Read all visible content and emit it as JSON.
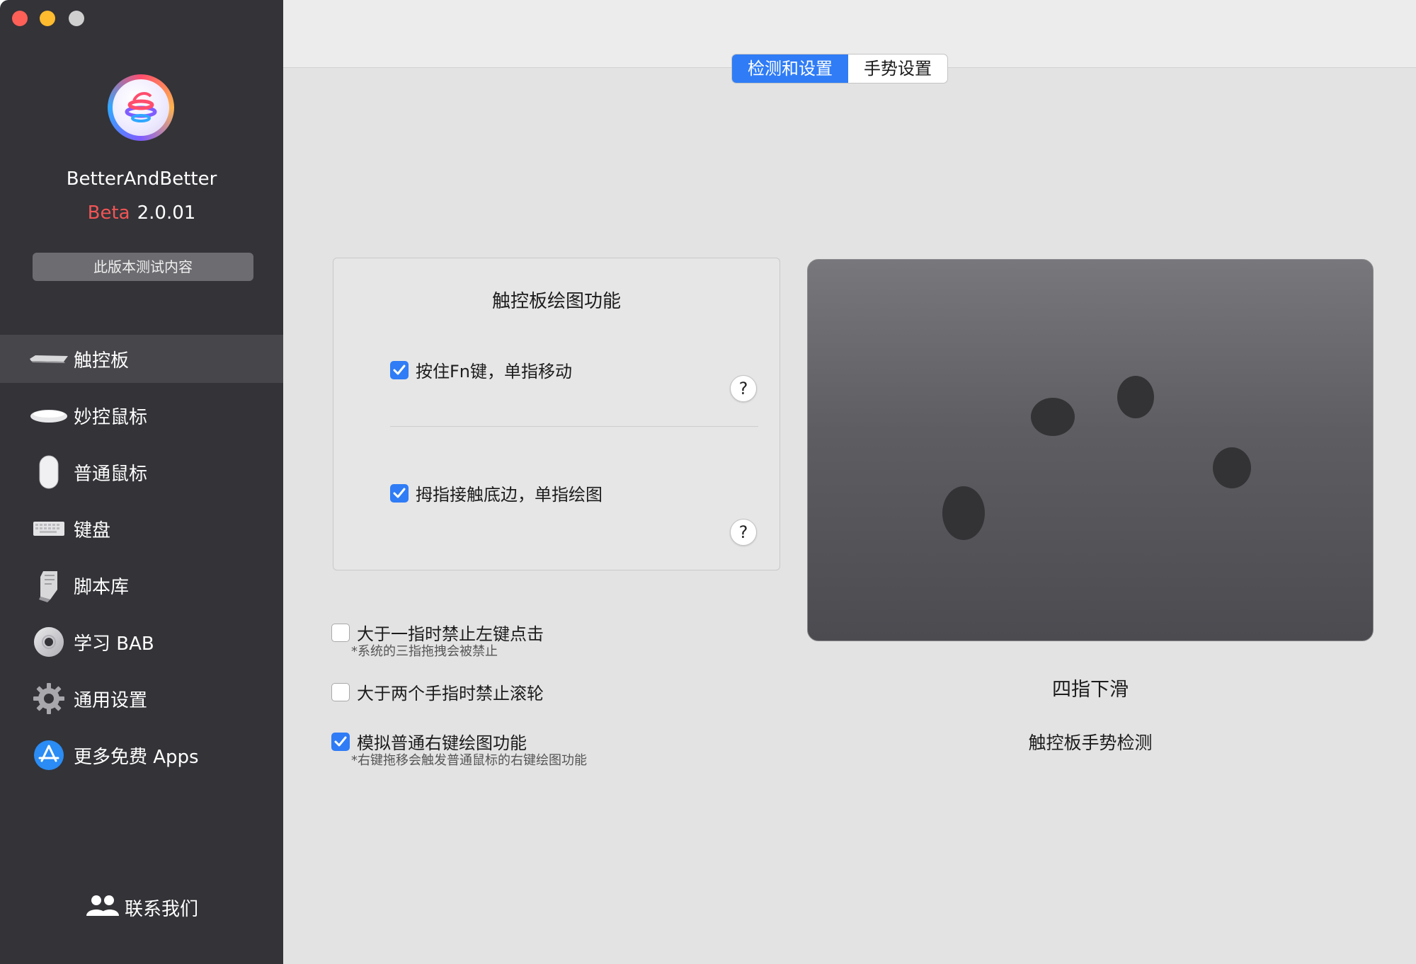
{
  "sidebar": {
    "app_name": "BetterAndBetter",
    "beta_label": "Beta",
    "version": "2.0.01",
    "test_content_button": "此版本测试内容",
    "items": [
      {
        "label": "触控板",
        "icon": "trackpad-icon",
        "active": true
      },
      {
        "label": "妙控鼠标",
        "icon": "magic-mouse-icon",
        "active": false
      },
      {
        "label": "普通鼠标",
        "icon": "mouse-icon",
        "active": false
      },
      {
        "label": "键盘",
        "icon": "keyboard-icon",
        "active": false
      },
      {
        "label": "脚本库",
        "icon": "script-library-icon",
        "active": false
      },
      {
        "label": "学习 BAB",
        "icon": "learn-dvd-icon",
        "active": false
      },
      {
        "label": "通用设置",
        "icon": "gear-icon",
        "active": false
      },
      {
        "label": "更多免费 Apps",
        "icon": "app-store-icon",
        "active": false
      }
    ],
    "contact": "联系我们",
    "colors": {
      "background": "#333338",
      "active": "#46464b",
      "beta": "#f25555"
    }
  },
  "tabs": [
    {
      "label": "检测和设置",
      "active": true
    },
    {
      "label": "手势设置",
      "active": false
    }
  ],
  "drawing": {
    "title": "触控板绘图功能",
    "options": [
      {
        "label": "按住Fn键，单指移动",
        "checked": true
      },
      {
        "label": "拇指接触底边，单指绘图",
        "checked": true
      }
    ],
    "help_symbol": "?"
  },
  "options": [
    {
      "label": "大于一指时禁止左键点击",
      "checked": false,
      "note": "*系统的三指拖拽会被禁止"
    },
    {
      "label": "大于两个手指时禁止滚轮",
      "checked": false,
      "note": ""
    },
    {
      "label": "模拟普通右键绘图功能",
      "checked": true,
      "note": "*右键拖移会触发普通鼠标的右键绘图功能"
    }
  ],
  "gesture": {
    "name": "四指下滑",
    "caption": "触控板手势检测",
    "touch_points": 4
  },
  "accent_color": "#2f7cf6"
}
